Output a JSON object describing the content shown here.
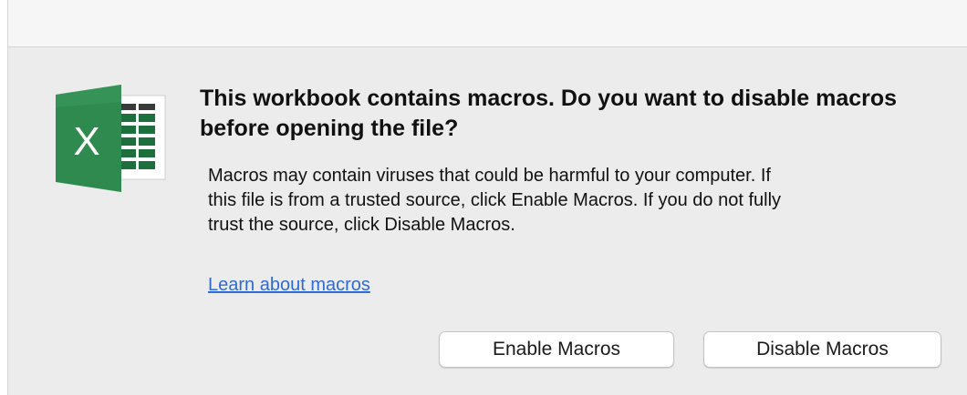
{
  "dialog": {
    "heading": "This workbook contains macros. Do you want to disable macros before opening the file?",
    "message_line1": "Macros may contain viruses that could be harmful to your computer.  If",
    "message_line2": "this file is from a trusted source, click Enable Macros. If you do not fully",
    "message_line3": "trust the source, click Disable Macros.",
    "learn_link": "Learn about macros",
    "enable_button": "Enable Macros",
    "disable_button": "Disable Macros"
  },
  "app_icon": {
    "name": "excel-icon",
    "letter": "X",
    "colors": {
      "dark_green": "#1e6f3e",
      "green": "#2f8a4f",
      "light_green": "#3c9a5f"
    }
  },
  "colors": {
    "background": "#ececec",
    "titlebar": "#f6f6f6",
    "link": "#2e6bd6"
  }
}
